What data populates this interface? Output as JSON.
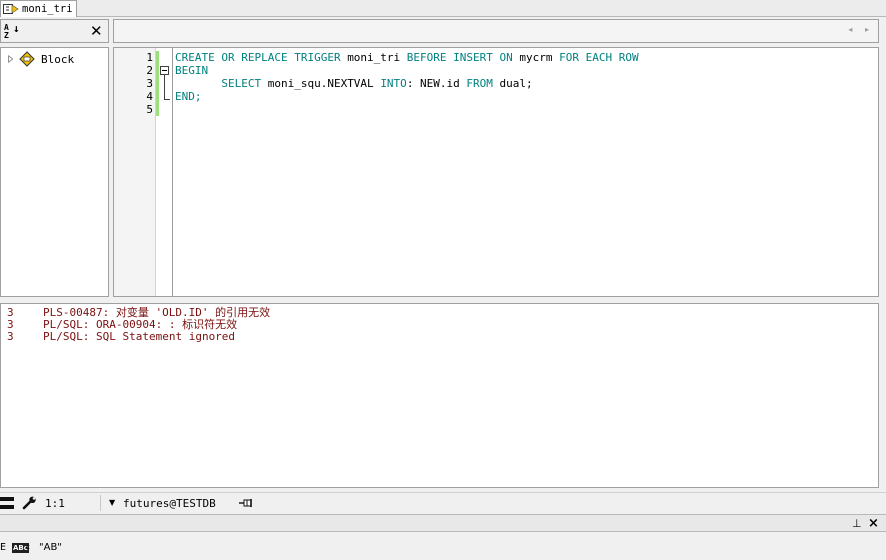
{
  "tab": {
    "title": "moni_tri",
    "icon": "trigger-icon"
  },
  "structure_toolbar": {
    "sort_label_top": "A",
    "sort_label_bottom": "Z",
    "sort_arrow": "↓",
    "close_label": "✕"
  },
  "nav": {
    "arrows": "◂ ▸"
  },
  "tree": {
    "items": [
      {
        "label": "Block",
        "icon": "block-icon"
      }
    ]
  },
  "editor": {
    "line_numbers": [
      "1",
      "2",
      "3",
      "4",
      "5"
    ],
    "lines": [
      [
        {
          "t": "CREATE OR REPLACE TRIGGER ",
          "k": "kw"
        },
        {
          "t": "moni_tri ",
          "k": "id"
        },
        {
          "t": "BEFORE INSERT ON ",
          "k": "kw"
        },
        {
          "t": "mycrm ",
          "k": "id"
        },
        {
          "t": "FOR EACH ROW",
          "k": "kw"
        }
      ],
      [
        {
          "t": "BEGIN",
          "k": "kw"
        }
      ],
      [
        {
          "t": "       SELECT ",
          "k": "kw"
        },
        {
          "t": "moni_squ.NEXTVAL ",
          "k": "id"
        },
        {
          "t": "INTO",
          "k": "kw"
        },
        {
          "t": ": NEW.id ",
          "k": "id"
        },
        {
          "t": "FROM ",
          "k": "kw"
        },
        {
          "t": "dual;",
          "k": "id"
        }
      ],
      [
        {
          "t": "END;",
          "k": "kw"
        }
      ],
      []
    ],
    "colors": {
      "keyword": "#008080",
      "identifier": "#000000",
      "change_bar": "#9be07c"
    }
  },
  "output": {
    "color": "#7a1010",
    "messages": [
      {
        "line": "3",
        "text": "PLS-00487: 对变量 'OLD.ID' 的引用无效"
      },
      {
        "line": "3",
        "text": "PL/SQL: ORA-00904: : 标识符无效"
      },
      {
        "line": "3",
        "text": "PL/SQL: SQL Statement ignored"
      }
    ]
  },
  "status": {
    "position": "1:1",
    "connection": "futures@TESTDB",
    "connection_arrow": "▼"
  },
  "dock": {
    "pin": "⊥",
    "close": "×"
  },
  "find": {
    "mode_label": "ABc",
    "case_c": "c",
    "text": "\"AB\"",
    "cut": "E"
  }
}
